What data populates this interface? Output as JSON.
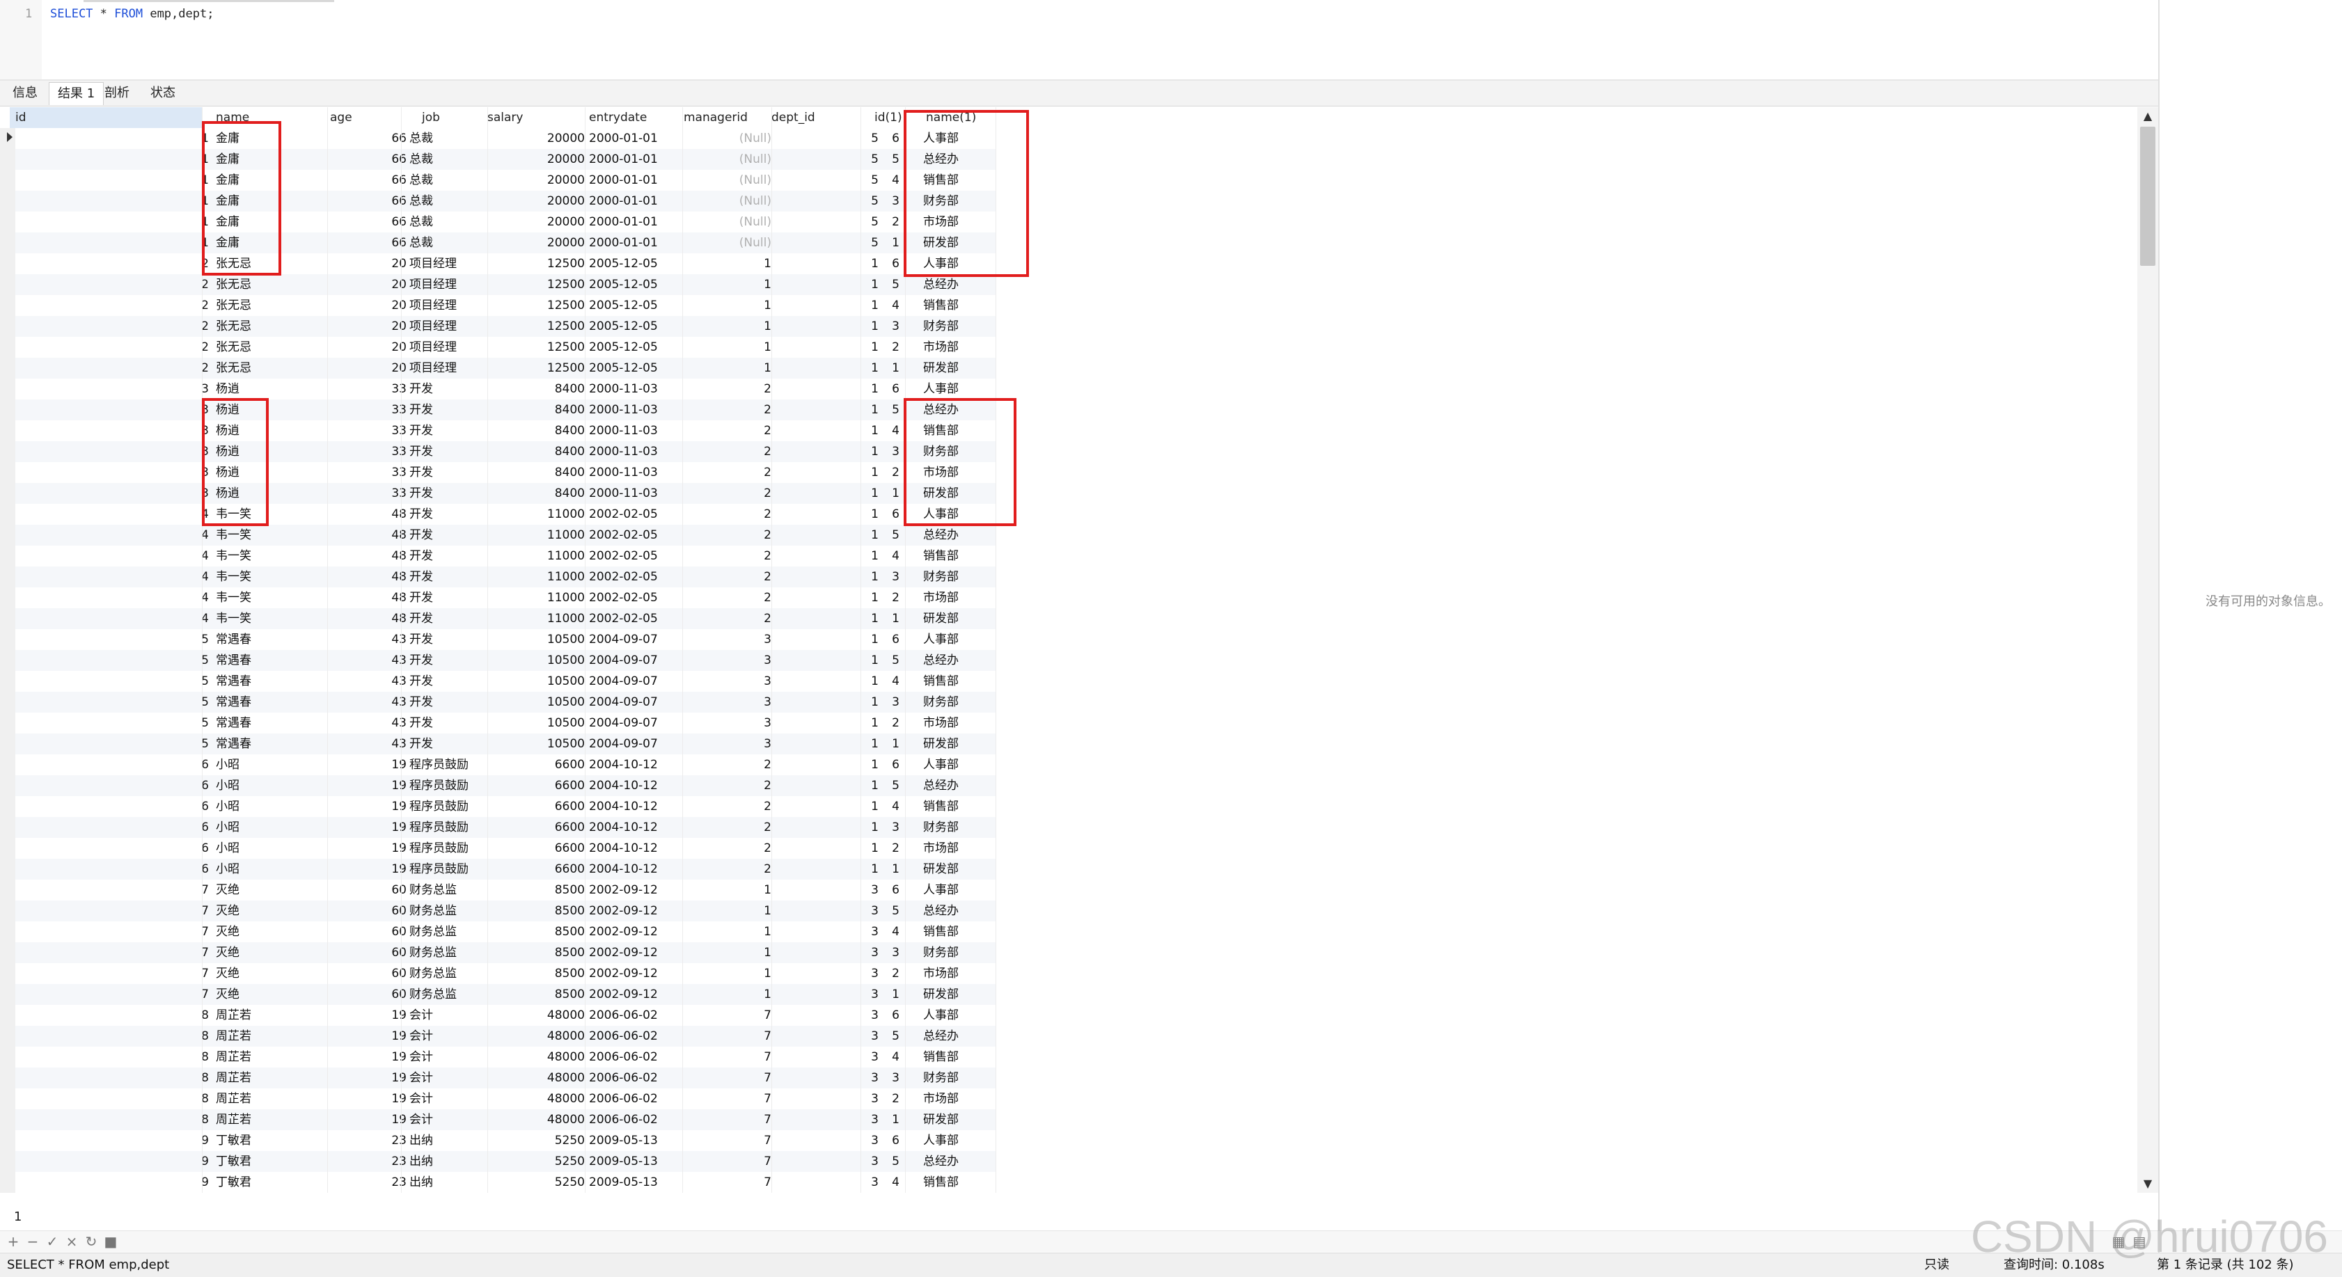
{
  "editor": {
    "line_number": "1",
    "kw1": "SELECT",
    "mid": " * ",
    "kw2": "FROM",
    "rest": " emp,dept;"
  },
  "tabs": [
    {
      "label": "信息",
      "active": false
    },
    {
      "label": "结果 1",
      "active": true
    },
    {
      "label": "剖析",
      "active": false
    },
    {
      "label": "状态",
      "active": false
    }
  ],
  "columns": [
    "id",
    "name",
    "age",
    "job",
    "salary",
    "entrydate",
    "managerid",
    "dept_id",
    "id(1)",
    "name(1)"
  ],
  "emps": [
    {
      "id": "1",
      "name": "金庸",
      "age": "66",
      "job": "总裁",
      "salary": "20000",
      "entrydate": "2000-01-01",
      "managerid": "(Null)",
      "dept_id": "5"
    },
    {
      "id": "2",
      "name": "张无忌",
      "age": "20",
      "job": "项目经理",
      "salary": "12500",
      "entrydate": "2005-12-05",
      "managerid": "1",
      "dept_id": "1"
    },
    {
      "id": "3",
      "name": "杨逍",
      "age": "33",
      "job": "开发",
      "salary": "8400",
      "entrydate": "2000-11-03",
      "managerid": "2",
      "dept_id": "1"
    },
    {
      "id": "4",
      "name": "韦一笑",
      "age": "48",
      "job": "开发",
      "salary": "11000",
      "entrydate": "2002-02-05",
      "managerid": "2",
      "dept_id": "1"
    },
    {
      "id": "5",
      "name": "常遇春",
      "age": "43",
      "job": "开发",
      "salary": "10500",
      "entrydate": "2004-09-07",
      "managerid": "3",
      "dept_id": "1"
    },
    {
      "id": "6",
      "name": "小昭",
      "age": "19",
      "job": "程序员鼓励",
      "salary": "6600",
      "entrydate": "2004-10-12",
      "managerid": "2",
      "dept_id": "1"
    },
    {
      "id": "7",
      "name": "灭绝",
      "age": "60",
      "job": "财务总监",
      "salary": "8500",
      "entrydate": "2002-09-12",
      "managerid": "1",
      "dept_id": "3"
    },
    {
      "id": "8",
      "name": "周芷若",
      "age": "19",
      "job": "会计",
      "salary": "48000",
      "entrydate": "2006-06-02",
      "managerid": "7",
      "dept_id": "3"
    },
    {
      "id": "9",
      "name": "丁敏君",
      "age": "23",
      "job": "出纳",
      "salary": "5250",
      "entrydate": "2009-05-13",
      "managerid": "7",
      "dept_id": "3"
    }
  ],
  "depts": [
    {
      "id": "6",
      "name": "人事部"
    },
    {
      "id": "5",
      "name": "总经办"
    },
    {
      "id": "4",
      "name": "销售部"
    },
    {
      "id": "3",
      "name": "财务部"
    },
    {
      "id": "2",
      "name": "市场部"
    },
    {
      "id": "1",
      "name": "研发部"
    }
  ],
  "visible_rows": 51,
  "info_panel": {
    "message": "没有可用的对象信息。"
  },
  "pager": {
    "page": "1"
  },
  "status": {
    "sql": "SELECT * FROM emp,dept",
    "mode": "只读",
    "query_time": "查询时间: 0.108s",
    "records": "第 1 条记录 (共 102 条)"
  },
  "watermark": "CSDN @hrui0706",
  "colors": {
    "highlight_box": "#e11d1d",
    "id_header": "#dce8f6",
    "keyword": "#1d4ed8"
  }
}
